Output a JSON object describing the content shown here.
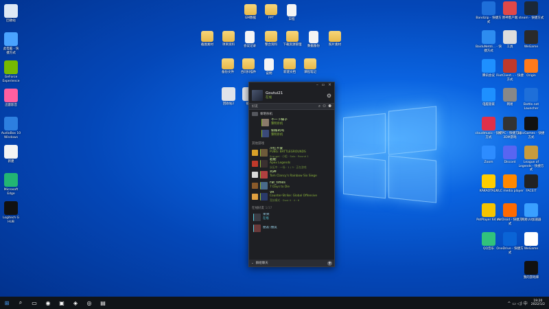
{
  "desktop": {
    "left_icons": [
      {
        "label": "回收站",
        "color": "#dfe9f5",
        "x": 0
      },
      {
        "label": "此电脑 - 快\n捷方式",
        "color": "#4aa3ff",
        "x": 0
      },
      {
        "label": "GeForce\nExperience",
        "color": "#76b900",
        "x": 0
      },
      {
        "label": "迅雷影音",
        "color": "#ff5fa0",
        "x": 0
      },
      {
        "label": "AudioBox 10\nWindows",
        "color": "#2d7fe0",
        "x": 0
      },
      {
        "label": "新建",
        "color": "#f4f4f4",
        "x": 0
      },
      {
        "label": "Microsoft\nEdge",
        "color": "#22b573",
        "x": 0
      },
      {
        "label": "Logitech G\nHUB",
        "color": "#111111",
        "x": 0
      }
    ],
    "top_row1": [
      "GM数据",
      "PPT",
      "日程"
    ],
    "top_row2": [
      "截图素材",
      "项目资料",
      "会议记录",
      "整合资料",
      "下载资源管理",
      "数据备份",
      "照片素材"
    ],
    "top_row3": [
      "备份文件",
      "合同扫描件",
      "说明",
      "新建文档",
      "课程笔记"
    ],
    "misc_icons": [
      "回收站2",
      "截图"
    ],
    "right_icons": [
      [
        "Bandizip - 快捷方式",
        "原神客户端",
        "steam - 快捷方式"
      ],
      [
        "BaiduNetdi... - 快捷方式",
        "工具",
        "WeGame"
      ],
      [
        "腾讯会议",
        "RiotClient... - 快捷方式",
        "Origin"
      ],
      [
        "电脑管家",
        "网易",
        "Battle.net Launcher"
      ],
      [
        "cloudmusic - 快捷方式",
        "XFPC - 快捷方式 3DM游戏",
        "EpicGames - 快捷方式"
      ],
      [
        "Zoom",
        "Discord",
        "League of Legends - 快捷方式"
      ],
      [
        "KAKAOTALK",
        "VLC media player",
        "FACEIT"
      ],
      [
        "PotPlayer 64 bit",
        "AirDroid - 快捷方式",
        "网易UU加速器"
      ],
      [
        "QQ音乐",
        "OneDrive - 快捷方式",
        "WeGame"
      ],
      [
        "",
        "",
        "我的游戏库"
      ]
    ]
  },
  "steam": {
    "username": "Goutui21",
    "status": "在线",
    "search_placeholder": "好友",
    "group_header": "黎明杀机",
    "group_friends": [
      {
        "name": "不一下婊子",
        "game": "黎明杀机"
      },
      {
        "name": "偷账的鸟",
        "game": "黎明杀机"
      }
    ],
    "section_other_games": "其他游戏",
    "friends": [
      {
        "name": "冷红不爱",
        "game": "PUBG: BATTLEGROUNDS",
        "detail": "Erangel · 小组 · Solo · Round 1",
        "avatar": "#6d5a3a",
        "game_color": "#d8a028"
      },
      {
        "name": "超能",
        "game": "Apex Legends",
        "detail": "队伍中 · 一场 · 1 / 3 · 正在游戏",
        "avatar": "#3a3030",
        "game_color": "#c0392b"
      },
      {
        "name": "鸡神",
        "game": "Tom Clancy's Rainbow Six Siege",
        "detail": "",
        "avatar": "#b04040",
        "game_color": "#d9d9d9"
      },
      {
        "name": "Fat_times",
        "game": "7 Days to Die",
        "detail": "",
        "avatar": "#4a6a8a",
        "game_color": "#8a5a2a"
      },
      {
        "name": "VA",
        "game": "Counter-Strike: Global Offensive",
        "detail": "竞技模式 · Dust II · 4 : 6",
        "avatar": "#2a3a6a",
        "game_color": "#e0a040"
      }
    ],
    "offline_header": "在线好友",
    "offline_count": "1/37",
    "offline_friends": [
      {
        "name": "呆呆",
        "status": "在线",
        "avatar": "#3a3c44"
      },
      {
        "name": "朋友-朋友",
        "status": "",
        "avatar": "#6a3a3a"
      }
    ],
    "chat_label": "群组聊天"
  },
  "taskbar": {
    "items": [
      "⊞",
      "⌕",
      "▭",
      "◉",
      "▣",
      "◈",
      "◎",
      "▤"
    ],
    "tray_text": "^ ▭ ◁) 中",
    "time": "19:20",
    "date": "2022/1/2"
  }
}
